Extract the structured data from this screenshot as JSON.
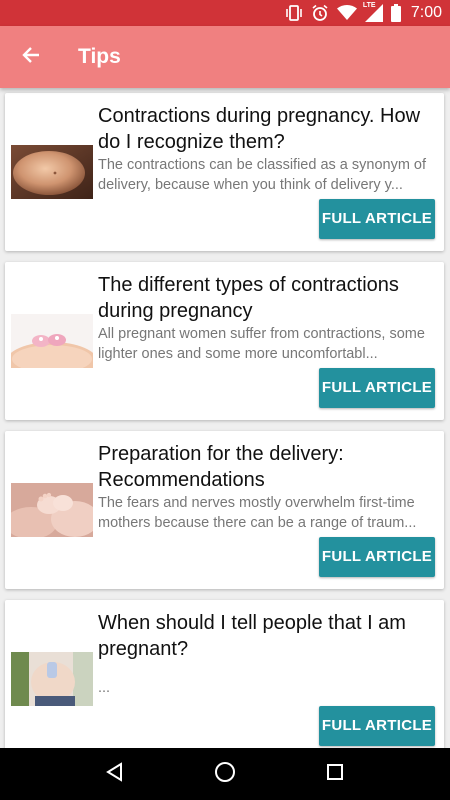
{
  "status_bar": {
    "time": "7:00",
    "icons": [
      "vibrate-icon",
      "alarm-icon",
      "wifi-icon",
      "lte-signal-icon",
      "battery-icon"
    ],
    "lte_label": "LTE",
    "background": "#d03338"
  },
  "app_bar": {
    "title": "Tips",
    "back_icon": "arrow-back-icon",
    "background": "#f08080"
  },
  "articles": [
    {
      "title": "Contractions during pregnancy. How do I recognize them?",
      "summary": "The contractions can be classified as a synonym of delivery, because when you think of delivery y...",
      "button": "FULL ARTICLE",
      "image": "pregnant-belly-photo"
    },
    {
      "title": "The different types of contractions during pregnancy",
      "summary": "All pregnant women suffer from contractions, some lighter ones and some more uncomfortabl...",
      "button": "FULL ARTICLE",
      "image": "belly-with-baby-shoes-photo"
    },
    {
      "title": "Preparation for the delivery: Recommendations",
      "summary": "The fears and nerves mostly overwhelm first-time mothers because there can be a range of traum...",
      "button": "FULL ARTICLE",
      "image": "baby-feet-in-hands-photo"
    },
    {
      "title": "When should I tell people that I am pregnant?",
      "summary": "...",
      "button": "FULL ARTICLE",
      "image": "belly-with-baby-clothes-photo"
    }
  ],
  "nav_bar": {
    "icons": [
      "back-triangle-icon",
      "home-circle-icon",
      "recents-square-icon"
    ]
  },
  "colors": {
    "accent": "#23919e",
    "card": "#ffffff",
    "background": "#efefef"
  }
}
